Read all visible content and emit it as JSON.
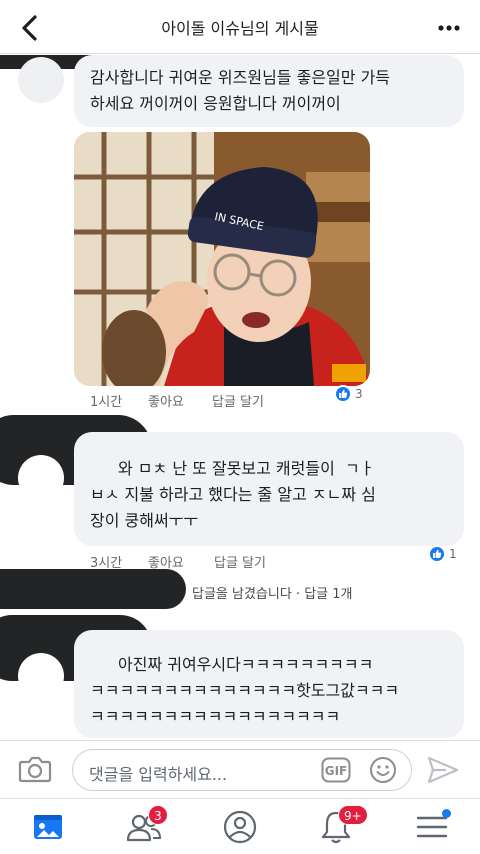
{
  "header": {
    "title": "아이돌 이슈님의 게시물"
  },
  "comments": [
    {
      "text_lines": [
        "감사합니다 귀여운 위즈원님들 좋은일만 가득",
        "하세요 꺼이꺼이 응원합니다 꺼이꺼이"
      ],
      "time": "1시간",
      "like_label": "좋아요",
      "reply_label": "답글 달기",
      "reaction_count": "3"
    },
    {
      "text_lines": [
        "와 ㅁㅊ 난 또 잘못보고 캐럿들이  ㄱㅏ",
        "ㅂㅅ 지불 하라고 했다는 줄 알고 ㅈㄴ짜 심",
        "장이 쿵해써ㅜㅜ"
      ],
      "time": "3시간",
      "like_label": "좋아요",
      "reply_label": "답글 달기",
      "reaction_count": "1",
      "reply_summary": "답글을 남겼습니다 · 답글 1개"
    },
    {
      "text_lines": [
        "아진짜 귀여우시다ㅋㅋㅋㅋㅋㅋㅋㅋㅋ",
        "ㅋㅋㅋㅋㅋㅋㅋㅋㅋㅋㅋㅋㅋㅋ핫도그값ㅋㅋㅋ",
        "ㅋㅋㅋㅋㅋㅋㅋㅋㅋㅋㅋㅋㅋㅋㅋㅋㅋ"
      ]
    }
  ],
  "photo": {
    "beanie_text": "IN SPACE"
  },
  "composer": {
    "placeholder": "댓글을 입력하세요...",
    "gif_label": "GIF"
  },
  "tabbar": {
    "friends_badge": "3",
    "notifications_badge": "9+"
  },
  "colors": {
    "accent": "#1877f2",
    "badge": "#e41e3f",
    "bubble": "#f0f2f5"
  }
}
